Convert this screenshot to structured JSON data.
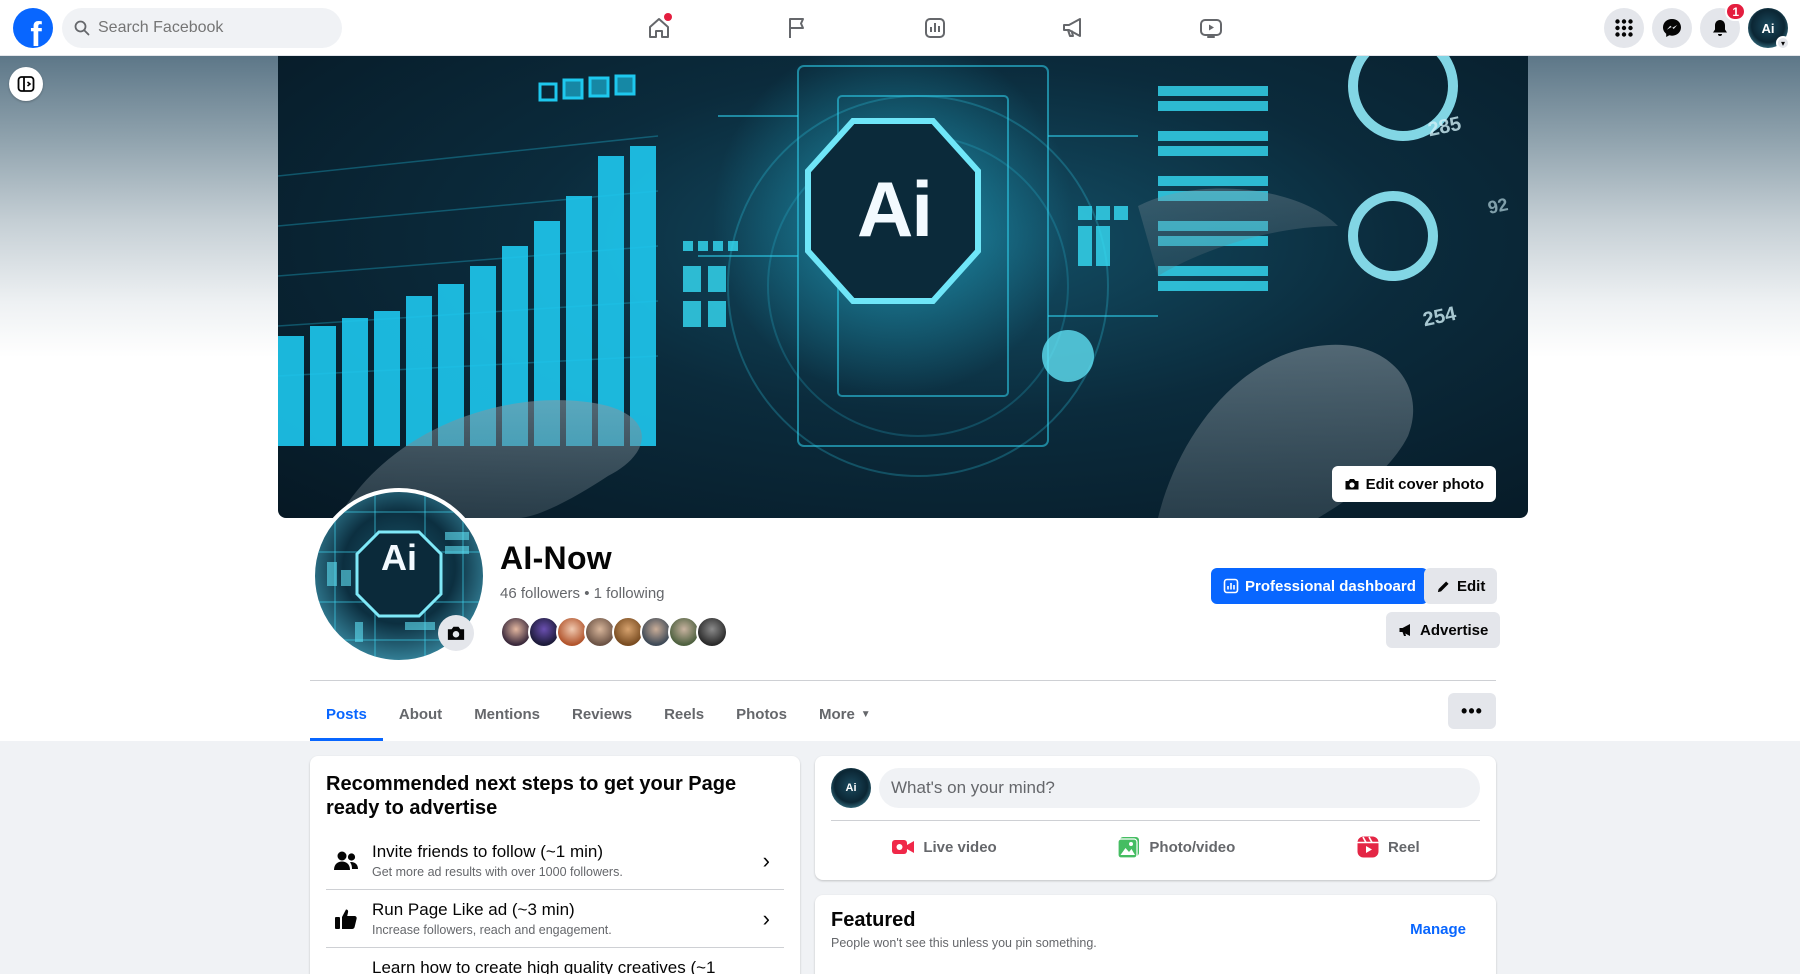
{
  "topbar": {
    "logo_letter": "f",
    "search_placeholder": "Search Facebook",
    "notifications_count": "1",
    "profile_initials": "Ai"
  },
  "cover": {
    "center_logo": "Ai",
    "edit_cover_label": "Edit cover photo",
    "side_numbers": [
      "285",
      "254",
      "92"
    ]
  },
  "profile": {
    "pic_logo": "Ai",
    "name": "AI-Now",
    "followers_text": "46 followers • 1 following"
  },
  "actions": {
    "dashboard_label": "Professional dashboard",
    "edit_label": "Edit",
    "advertise_label": "Advertise"
  },
  "tabs": [
    {
      "label": "Posts"
    },
    {
      "label": "About"
    },
    {
      "label": "Mentions"
    },
    {
      "label": "Reviews"
    },
    {
      "label": "Reels"
    },
    {
      "label": "Photos"
    },
    {
      "label": "More"
    }
  ],
  "recommended": {
    "title": "Recommended next steps to get your Page ready to advertise",
    "items": [
      {
        "title": "Invite friends to follow (~1 min)",
        "subtitle": "Get more ad results with over 1000 followers."
      },
      {
        "title": "Run Page Like ad (~3 min)",
        "subtitle": "Increase followers, reach and engagement."
      },
      {
        "title": "Learn how to create high quality creatives (~1",
        "subtitle": ""
      }
    ]
  },
  "composer": {
    "avatar_initials": "Ai",
    "placeholder": "What's on your mind?",
    "live_label": "Live video",
    "photo_label": "Photo/video",
    "reel_label": "Reel"
  },
  "featured": {
    "title": "Featured",
    "subtitle": "People won't see this unless you pin something.",
    "manage_label": "Manage"
  },
  "colors": {
    "brand": "#0866ff",
    "notification": "#e41e3f",
    "live": "#f02849",
    "photo": "#45bd62",
    "reel": "#e42645"
  }
}
